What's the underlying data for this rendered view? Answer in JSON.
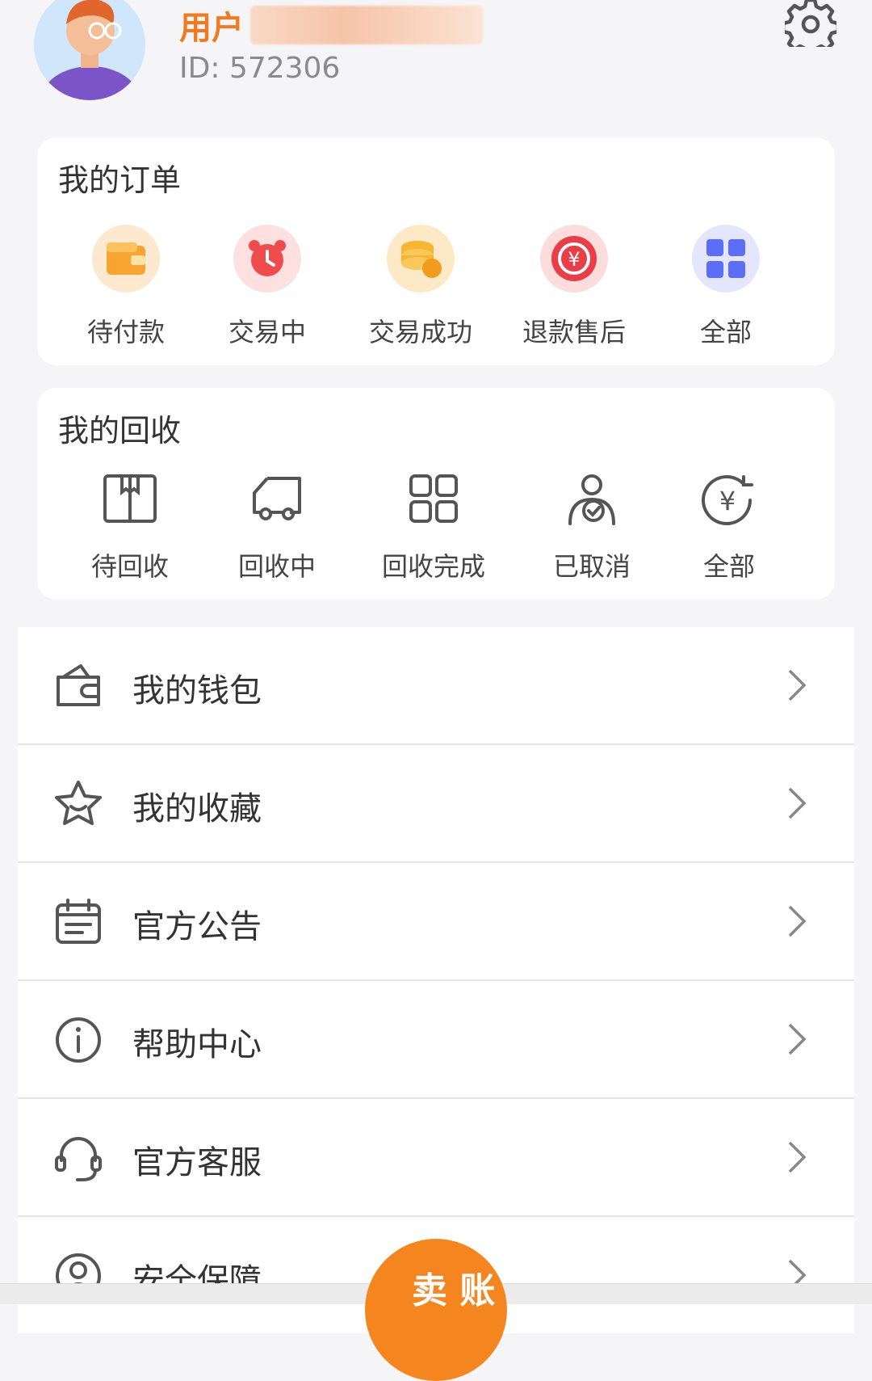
{
  "profile": {
    "username_label": "用户",
    "user_id": "ID: 572306",
    "icons": {
      "avatar": "avatar-illustration",
      "settings": "gear-icon"
    }
  },
  "orders": {
    "title": "我的订单",
    "items": [
      {
        "label": "待付款",
        "icon": "wallet-icon"
      },
      {
        "label": "交易中",
        "icon": "alarm-clock-icon"
      },
      {
        "label": "交易成功",
        "icon": "coins-icon"
      },
      {
        "label": "退款售后",
        "icon": "refund-yen-icon"
      },
      {
        "label": "全部",
        "icon": "grid-icon"
      }
    ]
  },
  "recycle": {
    "title": "我的回收",
    "items": [
      {
        "label": "待回收",
        "icon": "box-icon"
      },
      {
        "label": "回收中",
        "icon": "truck-icon"
      },
      {
        "label": "回收完成",
        "icon": "grid-outline-icon"
      },
      {
        "label": "已取消",
        "icon": "user-check-icon"
      },
      {
        "label": "全部",
        "icon": "yen-refresh-icon"
      }
    ]
  },
  "menu": [
    {
      "label": "我的钱包",
      "icon": "wallet-outline-icon"
    },
    {
      "label": "我的收藏",
      "icon": "star-icon"
    },
    {
      "label": "官方公告",
      "icon": "calendar-icon"
    },
    {
      "label": "帮助中心",
      "icon": "info-icon"
    },
    {
      "label": "官方客服",
      "icon": "headset-icon"
    },
    {
      "label": "安全保障",
      "icon": "shield-user-icon"
    }
  ],
  "fab": {
    "label": "卖 账"
  },
  "colors": {
    "accent": "#f07a1f",
    "background": "#f5f5f7"
  }
}
